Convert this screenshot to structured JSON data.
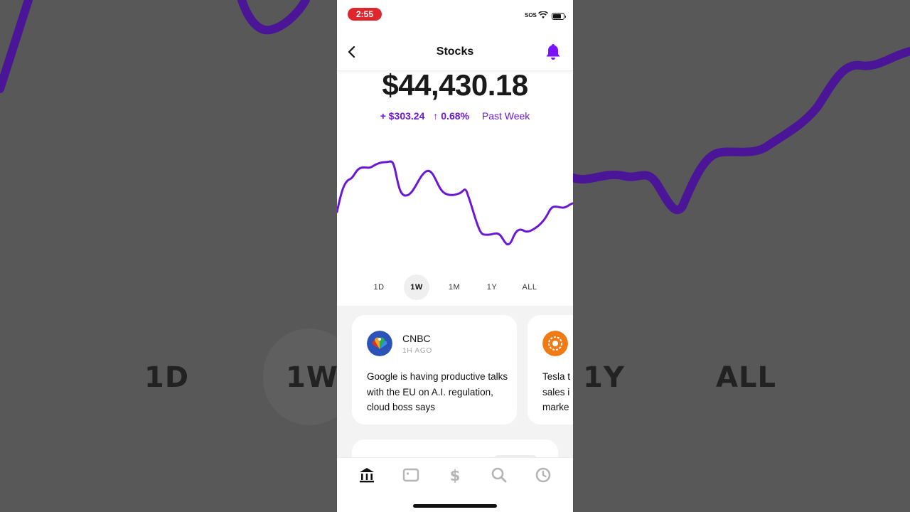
{
  "status_bar": {
    "time": "2:55",
    "sos": "SOS"
  },
  "nav": {
    "title": "Stocks"
  },
  "portfolio": {
    "balance": "$44,430.18",
    "change_amount": "+ $303.24",
    "change_percent": "0.68%",
    "period": "Past Week"
  },
  "ranges": [
    "1D",
    "1W",
    "1M",
    "1Y",
    "ALL"
  ],
  "active_range": "1W",
  "news": [
    {
      "source": "CNBC",
      "time": "1H AGO",
      "headline": "Google is having productive talks with the EU on A.I. regulation, cloud boss says"
    },
    {
      "source": "",
      "time": "",
      "headline": "Tesla t sales i marke"
    }
  ],
  "background": {
    "labels": [
      "1D",
      "1W",
      "1Y",
      "ALL"
    ]
  },
  "colors": {
    "accent": "#6b17d6",
    "time_pill": "#e0262d"
  },
  "tabs": [
    "home-icon",
    "card-icon",
    "dollar-icon",
    "search-icon",
    "clock-icon"
  ]
}
